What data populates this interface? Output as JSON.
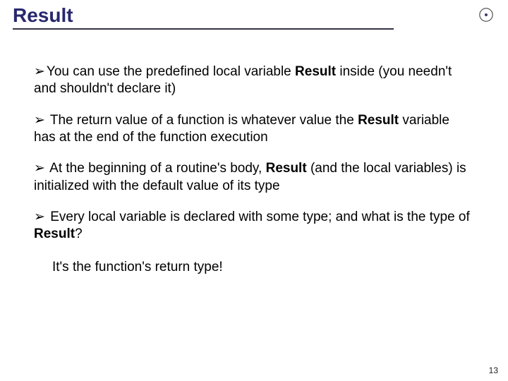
{
  "title": "Result",
  "arrow": "➢",
  "bullets": {
    "b1a": "You can use the predefined local variable ",
    "b1kw": "Result",
    "b1b": " inside (you needn't and shouldn't declare it)",
    "b2a": " The return value of a function is whatever value the ",
    "b2kw": "Result",
    "b2b": " variable has at the end of the function execution",
    "b3a": " At the beginning of a routine's body, ",
    "b3kw": "Result",
    "b3b": " (and the local variables) is initialized with the default value of its type",
    "b4a": " Every local variable is declared with some type; and what is the type of ",
    "b4kw": "Result",
    "b4b": "?"
  },
  "answer": "It's the function's return type!",
  "page_number": "13"
}
